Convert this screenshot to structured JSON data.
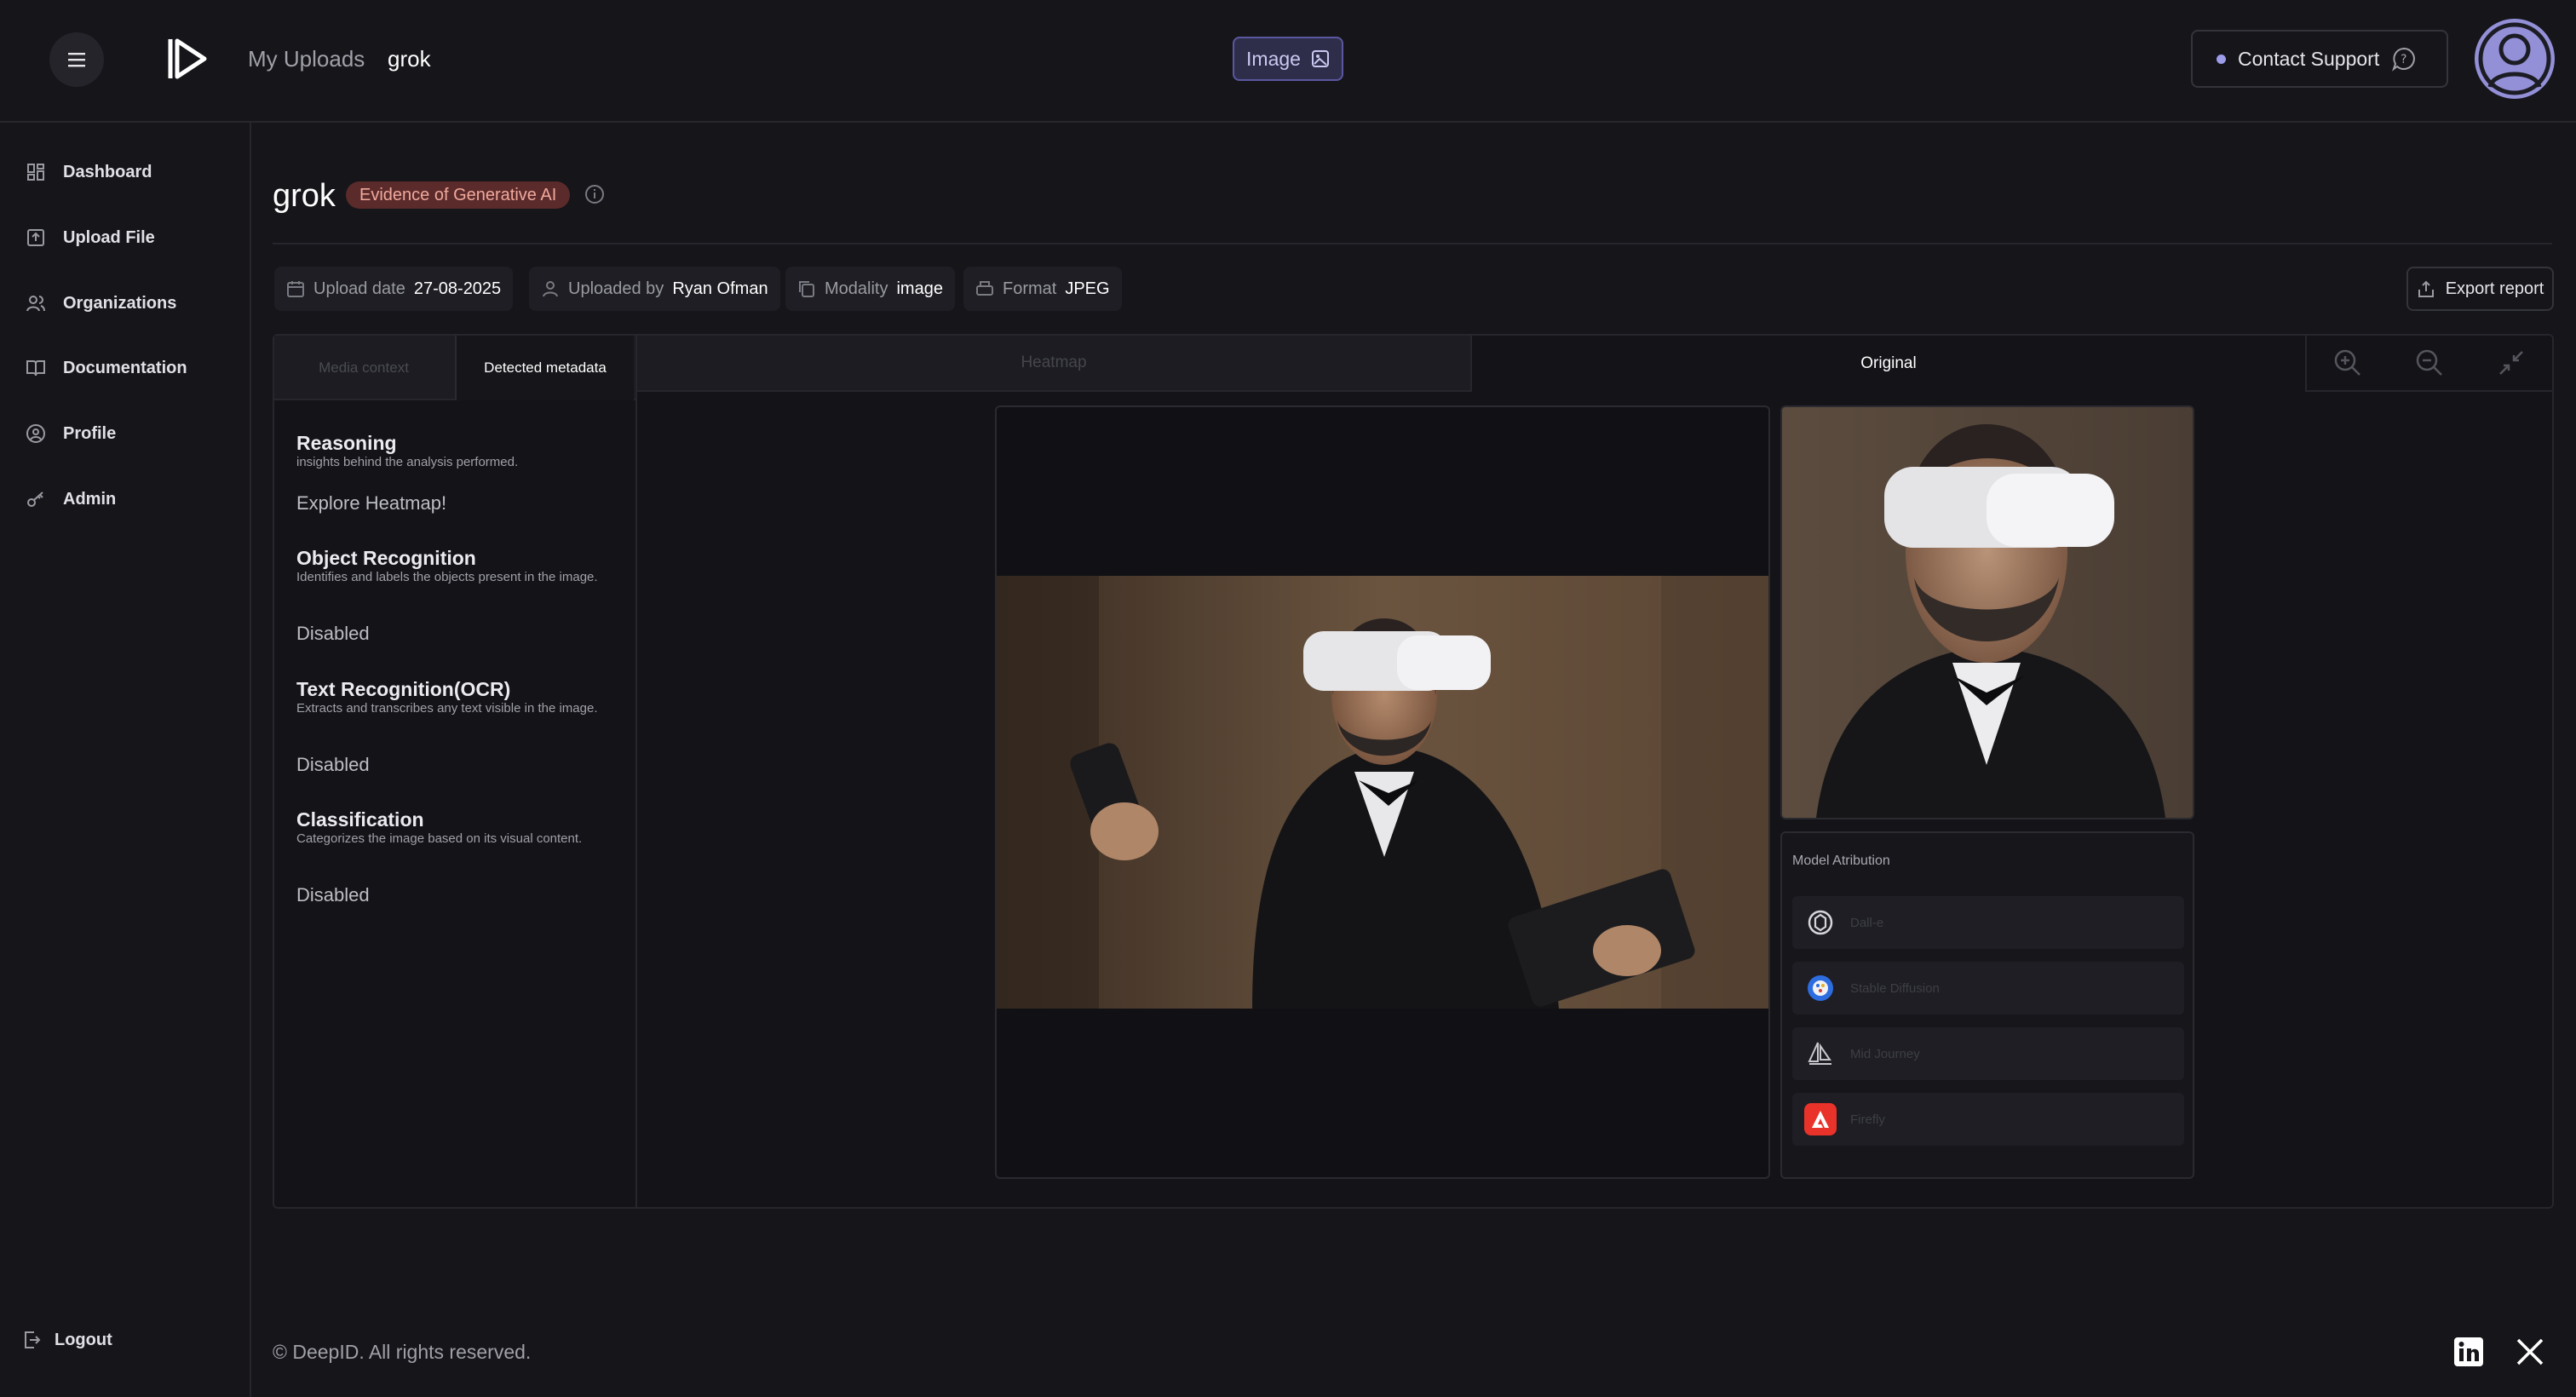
{
  "header": {
    "breadcrumb": [
      "My Uploads",
      "grok"
    ],
    "mode_label": "Image",
    "support_label": "Contact Support"
  },
  "sidebar": {
    "items": [
      {
        "label": "Dashboard",
        "icon": "dashboard-icon"
      },
      {
        "label": "Upload File",
        "icon": "upload-icon"
      },
      {
        "label": "Organizations",
        "icon": "users-icon"
      },
      {
        "label": "Documentation",
        "icon": "book-icon"
      },
      {
        "label": "Profile",
        "icon": "user-circle-icon"
      },
      {
        "label": "Admin",
        "icon": "key-icon"
      }
    ],
    "logout_label": "Logout"
  },
  "upload": {
    "title": "grok",
    "badge": "Evidence of Generative AI",
    "meta": {
      "upload_date_label": "Upload date",
      "upload_date": "27-08-2025",
      "uploaded_by_label": "Uploaded by",
      "uploaded_by": "Ryan Ofman",
      "modality_label": "Modality",
      "modality": "image",
      "format_label": "Format",
      "format": "JPEG"
    },
    "export_label": "Export report"
  },
  "left_tabs": [
    "Media context",
    "Detected metadata"
  ],
  "sections": [
    {
      "title": "Reasoning",
      "desc": "insights behind the analysis performed.",
      "value": "Explore Heatmap!"
    },
    {
      "title": "Object Recognition",
      "desc": "Identifies and labels the objects present in the image.",
      "value": "Disabled"
    },
    {
      "title": "Text Recognition(OCR)",
      "desc": "Extracts and transcribes any text visible in the image.",
      "value": "Disabled"
    },
    {
      "title": "Classification",
      "desc": "Categorizes the image based on its visual content.",
      "value": "Disabled"
    }
  ],
  "view_tabs": [
    "Heatmap",
    "Original"
  ],
  "attribution": {
    "title": "Model Atribution",
    "models": [
      "Dall-e",
      "Stable Diffusion",
      "Mid Journey",
      "Firefly"
    ]
  },
  "footer": {
    "copyright": "© DeepID. All rights reserved."
  },
  "colors": {
    "accent": "#9390d8",
    "badge_bg": "#5b2b2b",
    "badge_fg": "#f0a99c",
    "background": "#15151a"
  }
}
